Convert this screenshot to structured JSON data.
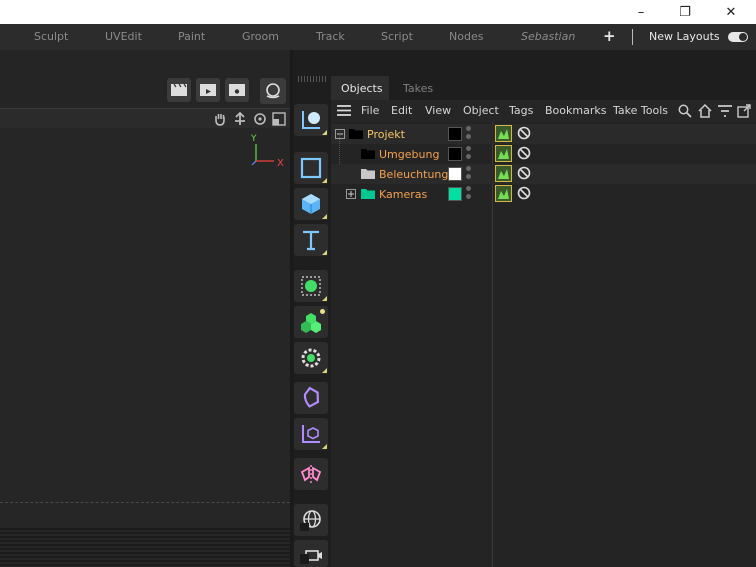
{
  "window": {
    "controls": [
      "–",
      "❐",
      "✕"
    ]
  },
  "layouts": {
    "tabs": [
      "Sculpt",
      "UVEdit",
      "Paint",
      "Groom",
      "Track",
      "Script",
      "Nodes",
      "Sebastian"
    ],
    "new_layouts_label": "New Layouts"
  },
  "viewport": {
    "axis_y": "Y",
    "axis_x": "X"
  },
  "objects_panel": {
    "tabs": [
      {
        "label": "Objects",
        "active": true
      },
      {
        "label": "Takes",
        "active": false
      }
    ],
    "menu": [
      "File",
      "Edit",
      "View",
      "Object",
      "Tags",
      "Bookmarks",
      "Take Tools"
    ],
    "objects": [
      {
        "name": "Projekt",
        "color": "#000000",
        "folder_color": "#000000",
        "expanded": true
      },
      {
        "name": "Umgebung",
        "color": "#000000",
        "folder_color": "#000000"
      },
      {
        "name": "Beleuchtung",
        "color": "#ffffff",
        "folder_color": "#c8c8c8"
      },
      {
        "name": "Kameras",
        "color": "#00e0a0",
        "folder_color": "#00c890",
        "expanded": false
      }
    ]
  },
  "icons": {
    "toolbar": [
      "clapper-icon",
      "clapper-play-icon",
      "clapper-settings-icon",
      "render-settings-icon"
    ],
    "viewport_nav": [
      "hand-icon",
      "move-icon",
      "rotate-icon",
      "maximize-icon"
    ],
    "tools": [
      "null-object-icon",
      "rectangle-icon",
      "cube-icon",
      "text-icon",
      "spline-pen-icon",
      "mograph-cloner-icon",
      "deformer-icon",
      "field-icon",
      "coordinate-icon",
      "symmetry-icon",
      "globe-icon",
      "camera-icon"
    ]
  },
  "colors": {
    "accent_orange": "#f5a04e",
    "tool_blue": "#7fc8ff",
    "tool_green": "#44dd66",
    "tool_purple": "#b08cff",
    "tool_pink": "#ff8cd0"
  }
}
